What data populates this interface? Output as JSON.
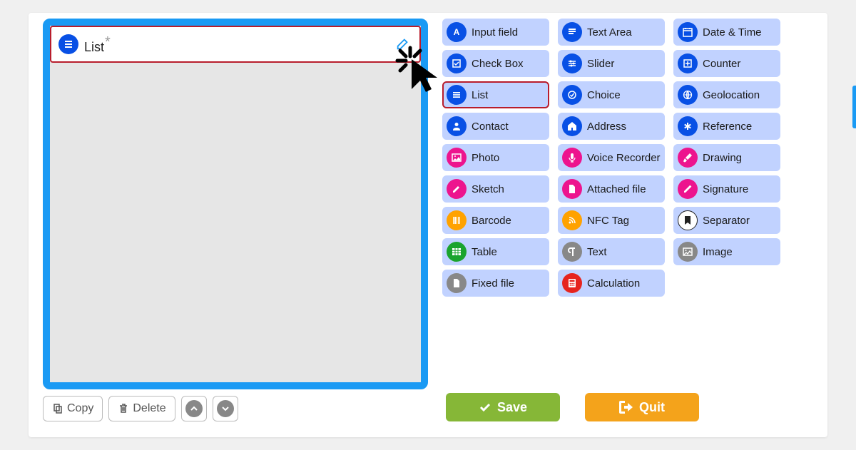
{
  "canvas": {
    "field_label": "List",
    "field_icon": "list-icon"
  },
  "toolbar": {
    "copy_label": "Copy",
    "delete_label": "Delete"
  },
  "palette": {
    "cols": [
      [
        {
          "label": "Input field",
          "icon": "letter-a-icon",
          "color": "blue"
        },
        {
          "label": "Check Box",
          "icon": "checkbox-icon",
          "color": "blue"
        },
        {
          "label": "List",
          "icon": "list-icon",
          "color": "blue",
          "selected": true
        },
        {
          "label": "Contact",
          "icon": "person-icon",
          "color": "blue"
        },
        {
          "label": "Photo",
          "icon": "photo-icon",
          "color": "pink"
        },
        {
          "label": "Sketch",
          "icon": "pencil-icon",
          "color": "pink"
        },
        {
          "label": "Barcode",
          "icon": "barcode-icon",
          "color": "orange"
        },
        {
          "label": "Table",
          "icon": "table-icon",
          "color": "green"
        },
        {
          "label": "Fixed file",
          "icon": "file-icon",
          "color": "gray"
        }
      ],
      [
        {
          "label": "Text Area",
          "icon": "textarea-icon",
          "color": "blue"
        },
        {
          "label": "Slider",
          "icon": "slider-icon",
          "color": "blue"
        },
        {
          "label": "Choice",
          "icon": "check-circle-icon",
          "color": "blue"
        },
        {
          "label": "Address",
          "icon": "home-icon",
          "color": "blue"
        },
        {
          "label": "Voice Recorder",
          "icon": "mic-icon",
          "color": "pink"
        },
        {
          "label": "Attached file",
          "icon": "file-icon",
          "color": "pink"
        },
        {
          "label": "NFC Tag",
          "icon": "rss-icon",
          "color": "orange"
        },
        {
          "label": "Text",
          "icon": "paragraph-icon",
          "color": "gray"
        },
        {
          "label": "Calculation",
          "icon": "calculator-icon",
          "color": "red"
        }
      ],
      [
        {
          "label": "Date & Time",
          "icon": "calendar-icon",
          "color": "blue"
        },
        {
          "label": "Counter",
          "icon": "plus-box-icon",
          "color": "blue"
        },
        {
          "label": "Geolocation",
          "icon": "globe-icon",
          "color": "blue"
        },
        {
          "label": "Reference",
          "icon": "asterisk-icon",
          "color": "blue"
        },
        {
          "label": "Drawing",
          "icon": "brush-icon",
          "color": "pink"
        },
        {
          "label": "Signature",
          "icon": "pen-icon",
          "color": "pink"
        },
        {
          "label": "Separator",
          "icon": "bookmark-icon",
          "color": "white"
        },
        {
          "label": "Image",
          "icon": "image-icon",
          "color": "gray"
        }
      ]
    ]
  },
  "actions": {
    "save_label": "Save",
    "quit_label": "Quit"
  }
}
